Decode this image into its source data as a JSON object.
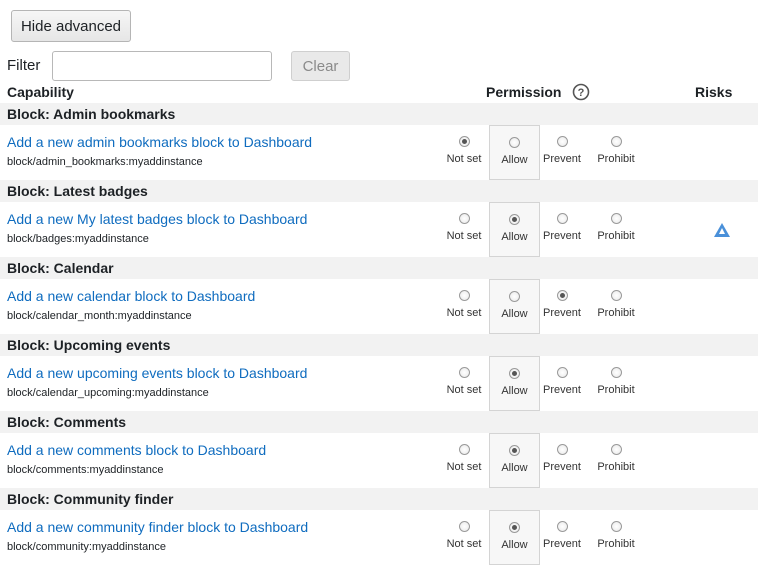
{
  "toolbar": {
    "hide_advanced_label": "Hide advanced"
  },
  "filter": {
    "label": "Filter",
    "value": "",
    "placeholder": "",
    "clear_label": "Clear"
  },
  "table_headers": {
    "capability": "Capability",
    "permission": "Permission",
    "risks": "Risks"
  },
  "permission_options": [
    "Not set",
    "Allow",
    "Prevent",
    "Prohibit"
  ],
  "groups": [
    {
      "title": "Block: Admin bookmarks",
      "link": "Add a new admin bookmarks block to Dashboard",
      "capability": "block/admin_bookmarks:myaddinstance",
      "selected": "Not set",
      "risk": false
    },
    {
      "title": "Block: Latest badges",
      "link": "Add a new My latest badges block to Dashboard",
      "capability": "block/badges:myaddinstance",
      "selected": "Allow",
      "risk": true
    },
    {
      "title": "Block: Calendar",
      "link": "Add a new calendar block to Dashboard",
      "capability": "block/calendar_month:myaddinstance",
      "selected": "Prevent",
      "risk": false
    },
    {
      "title": "Block: Upcoming events",
      "link": "Add a new upcoming events block to Dashboard",
      "capability": "block/calendar_upcoming:myaddinstance",
      "selected": "Allow",
      "risk": false
    },
    {
      "title": "Block: Comments",
      "link": "Add a new comments block to Dashboard",
      "capability": "block/comments:myaddinstance",
      "selected": "Allow",
      "risk": false
    },
    {
      "title": "Block: Community finder",
      "link": "Add a new community finder block to Dashboard",
      "capability": "block/community:myaddinstance",
      "selected": "Allow",
      "risk": false
    }
  ],
  "colors": {
    "link": "#0f6cbf",
    "group_header_bg": "#f2f2f2",
    "risk_icon": "#4a90d9"
  },
  "icons": {
    "help": "question-circle-icon",
    "risk": "risk-warning-icon"
  }
}
